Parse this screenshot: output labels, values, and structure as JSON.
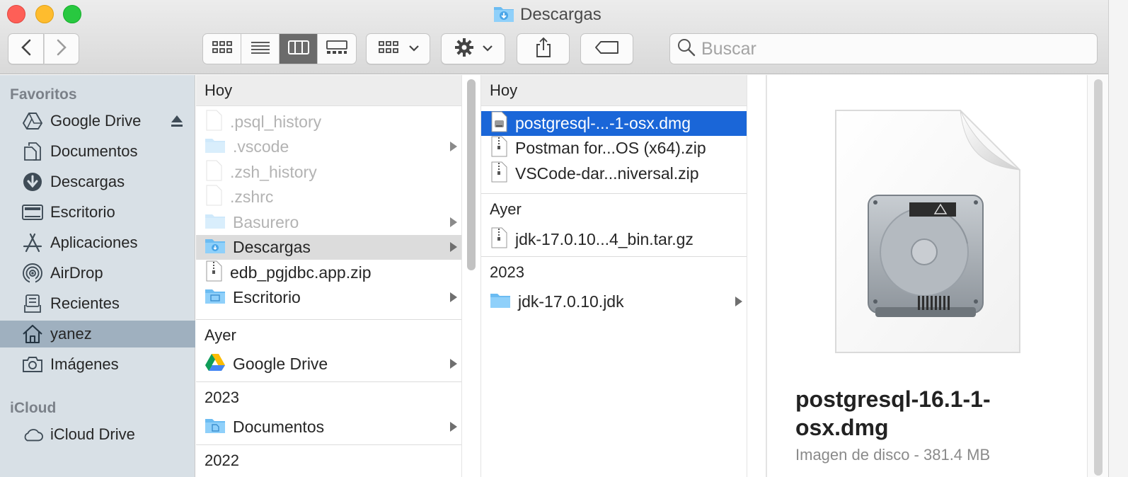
{
  "window": {
    "title": "Descargas"
  },
  "toolbar": {
    "back_icon": "chevron-left-icon",
    "forward_icon": "chevron-right-icon",
    "view_modes": [
      "icon-view",
      "list-view",
      "column-view",
      "gallery-view"
    ],
    "active_view": "column-view",
    "search_placeholder": "Buscar"
  },
  "sidebar": {
    "favorites_label": "Favoritos",
    "favorites": [
      {
        "label": "Google Drive",
        "icon": "google-drive-icon",
        "eject": true
      },
      {
        "label": "Documentos",
        "icon": "document-icon"
      },
      {
        "label": "Descargas",
        "icon": "download-icon"
      },
      {
        "label": "Escritorio",
        "icon": "desktop-icon"
      },
      {
        "label": "Aplicaciones",
        "icon": "applications-icon"
      },
      {
        "label": "AirDrop",
        "icon": "airdrop-icon"
      },
      {
        "label": "Recientes",
        "icon": "recents-icon"
      },
      {
        "label": "yanez",
        "icon": "home-icon",
        "selected": true
      },
      {
        "label": "Imágenes",
        "icon": "camera-icon"
      }
    ],
    "icloud_label": "iCloud",
    "icloud": [
      {
        "label": "iCloud Drive",
        "icon": "cloud-icon"
      }
    ]
  },
  "column1": {
    "groups": [
      {
        "header": "Hoy",
        "items": [
          {
            "label": ".psql_history",
            "type": "file",
            "dim": true
          },
          {
            "label": ".vscode",
            "type": "folder",
            "dim": true,
            "arrow": true
          },
          {
            "label": ".zsh_history",
            "type": "file",
            "dim": true
          },
          {
            "label": ".zshrc",
            "type": "file",
            "dim": true
          },
          {
            "label": "Basurero",
            "type": "folder",
            "dim": true,
            "arrow": true
          },
          {
            "label": "Descargas",
            "type": "folder-download",
            "highlight": true,
            "arrow": true
          },
          {
            "label": "edb_pgjdbc.app.zip",
            "type": "zip"
          },
          {
            "label": "Escritorio",
            "type": "folder-desktop",
            "arrow": true
          }
        ]
      },
      {
        "header": "Ayer",
        "items": [
          {
            "label": "Google Drive",
            "type": "google-drive",
            "arrow": true
          }
        ]
      },
      {
        "header": "2023",
        "items": [
          {
            "label": "Documentos",
            "type": "folder-docs",
            "arrow": true
          }
        ]
      },
      {
        "header": "2022",
        "items": []
      }
    ]
  },
  "column2": {
    "groups": [
      {
        "header": "Hoy",
        "items": [
          {
            "label": "postgresql-...-1-osx.dmg",
            "type": "dmg",
            "selected": true
          },
          {
            "label": "Postman for...OS (x64).zip",
            "type": "zip"
          },
          {
            "label": "VSCode-dar...niversal.zip",
            "type": "zip"
          }
        ]
      },
      {
        "header": "Ayer",
        "items": [
          {
            "label": "jdk-17.0.10...4_bin.tar.gz",
            "type": "zip"
          }
        ]
      },
      {
        "header": "2023",
        "items": [
          {
            "label": "jdk-17.0.10.jdk",
            "type": "folder",
            "arrow": true
          }
        ]
      }
    ]
  },
  "preview": {
    "name": "postgresql-16.1-1-osx.dmg",
    "kind": "Imagen de disco - 381.4 MB",
    "icon": "disk-image-icon"
  },
  "colors": {
    "selection": "#1a66d8",
    "sidebar_bg": "#d8e0e6",
    "sidebar_selected": "#9fb0bf",
    "folder": "#6bbcf2"
  }
}
